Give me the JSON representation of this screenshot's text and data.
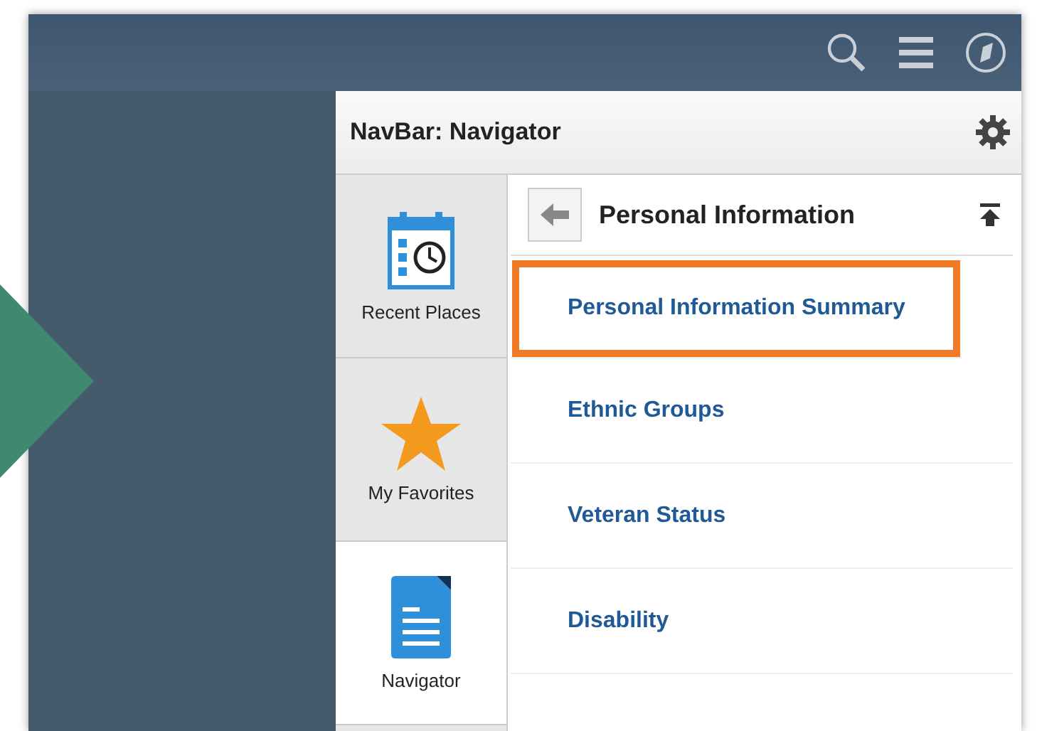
{
  "panel": {
    "title": "NavBar: Navigator"
  },
  "tabs": [
    {
      "label": "Recent Places",
      "kind": "recent",
      "selected": false
    },
    {
      "label": "My Favorites",
      "kind": "favorites",
      "selected": false
    },
    {
      "label": "Navigator",
      "kind": "navigator",
      "selected": true
    }
  ],
  "breadcrumb": {
    "title": "Personal Information"
  },
  "items": [
    {
      "label": "Personal Information Summary",
      "highlighted": true
    },
    {
      "label": "Ethnic Groups",
      "highlighted": false
    },
    {
      "label": "Veteran Status",
      "highlighted": false
    },
    {
      "label": "Disability",
      "highlighted": false
    }
  ]
}
